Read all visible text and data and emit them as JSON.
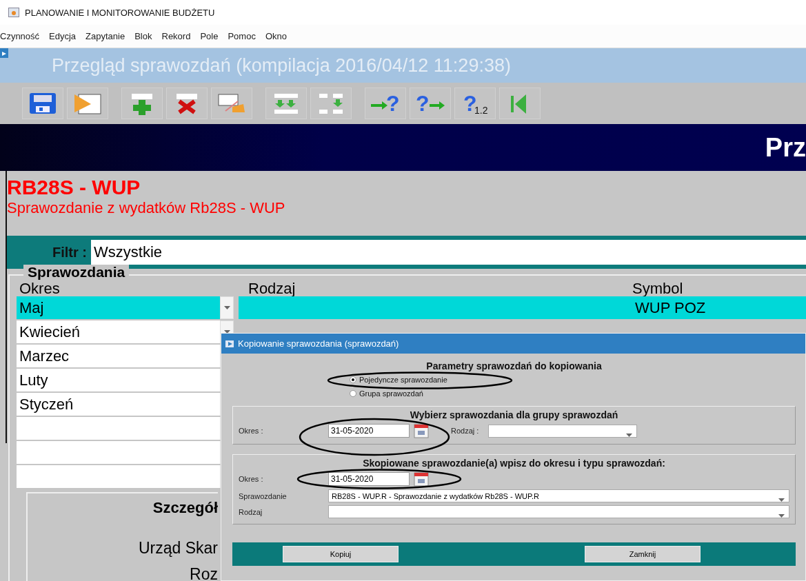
{
  "window": {
    "title": "PLANOWANIE I MONITOROWANIE BUDŻETU"
  },
  "menu": [
    "Czynność",
    "Edycja",
    "Zapytanie",
    "Blok",
    "Rekord",
    "Pole",
    "Pomoc",
    "Okno"
  ],
  "form_title": "Przegląd sprawozdań (kompilacja 2016/04/12 11:29:38)",
  "toolbar": [
    {
      "kind": "save"
    },
    {
      "kind": "run"
    },
    {
      "kind": "add"
    },
    {
      "kind": "delete"
    },
    {
      "kind": "erase"
    },
    {
      "kind": "down-all"
    },
    {
      "kind": "down-one"
    },
    {
      "kind": "query-in",
      "glyph": "?"
    },
    {
      "kind": "query-out",
      "glyph": "?"
    },
    {
      "kind": "query-count",
      "glyph": "?",
      "sub": "1.2"
    },
    {
      "kind": "first"
    }
  ],
  "banner": "Prz",
  "report": {
    "code": "RB28S - WUP",
    "name": "Sprawozdanie z wydatków Rb28S - WUP"
  },
  "filter": {
    "label": "Filtr :",
    "value": "Wszystkie"
  },
  "group": {
    "title": "Sprawozdania",
    "columns": [
      "Okres",
      "Rodzaj",
      "Symbol"
    ],
    "rows": [
      {
        "okres": "Maj",
        "symbol": "WUP POZ",
        "selected": true
      },
      {
        "okres": "Kwiecień",
        "selected": false
      },
      {
        "okres": "Marzec",
        "selected": false
      },
      {
        "okres": "Luty",
        "selected": false
      },
      {
        "okres": "Styczeń",
        "selected": false
      },
      {
        "selected": false
      },
      {
        "selected": false
      },
      {
        "selected": false
      }
    ],
    "details": {
      "title": "Szczegół",
      "lines": [
        "Urząd Skar",
        "Roz"
      ]
    }
  },
  "dialog": {
    "title": "Kopiowanie sprawozdania (sprawozdań)",
    "heading": "Parametry sprawozdań do kopiowania",
    "options": [
      {
        "label": "Pojedyncze sprawozdanie",
        "selected": true
      },
      {
        "label": "Grupa sprawozdań",
        "selected": false
      }
    ],
    "source": {
      "title": "Wybierz sprawozdania dla grupy sprawozdań",
      "okres_label": "Okres :",
      "okres": "31-05-2020",
      "rodzaj_label": "Rodzaj :"
    },
    "target": {
      "title": "Skopiowane sprawozdanie(a) wpisz do okresu i typu sprawozdań:",
      "okres_label": "Okres :",
      "okres": "31-05-2020",
      "sprawozdanie_label": "Sprawozdanie",
      "sprawozdanie": "RB28S - WUP.R - Sprawozdanie z wydatków Rb28S - WUP.R",
      "rodzaj_label": "Rodzaj"
    },
    "buttons": [
      "Kopiuj",
      "Zamknij"
    ]
  }
}
